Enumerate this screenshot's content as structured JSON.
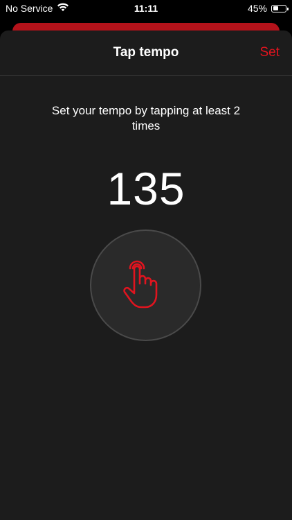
{
  "status_bar": {
    "carrier": "No Service",
    "time": "11:11",
    "battery_percent": "45%",
    "battery_level": 0.45,
    "wifi_icon": "wifi-icon"
  },
  "sheet": {
    "title": "Tap tempo",
    "set_label": "Set"
  },
  "tap_tempo": {
    "instruction": "Set your tempo by tapping at least 2 times",
    "bpm": "135",
    "tap_icon": "tap-hand-icon"
  },
  "colors": {
    "accent": "#e0141f",
    "sheet_background": "#1c1c1c",
    "behind_card": "#b3121a",
    "tap_button_background": "#2a2a2a"
  }
}
